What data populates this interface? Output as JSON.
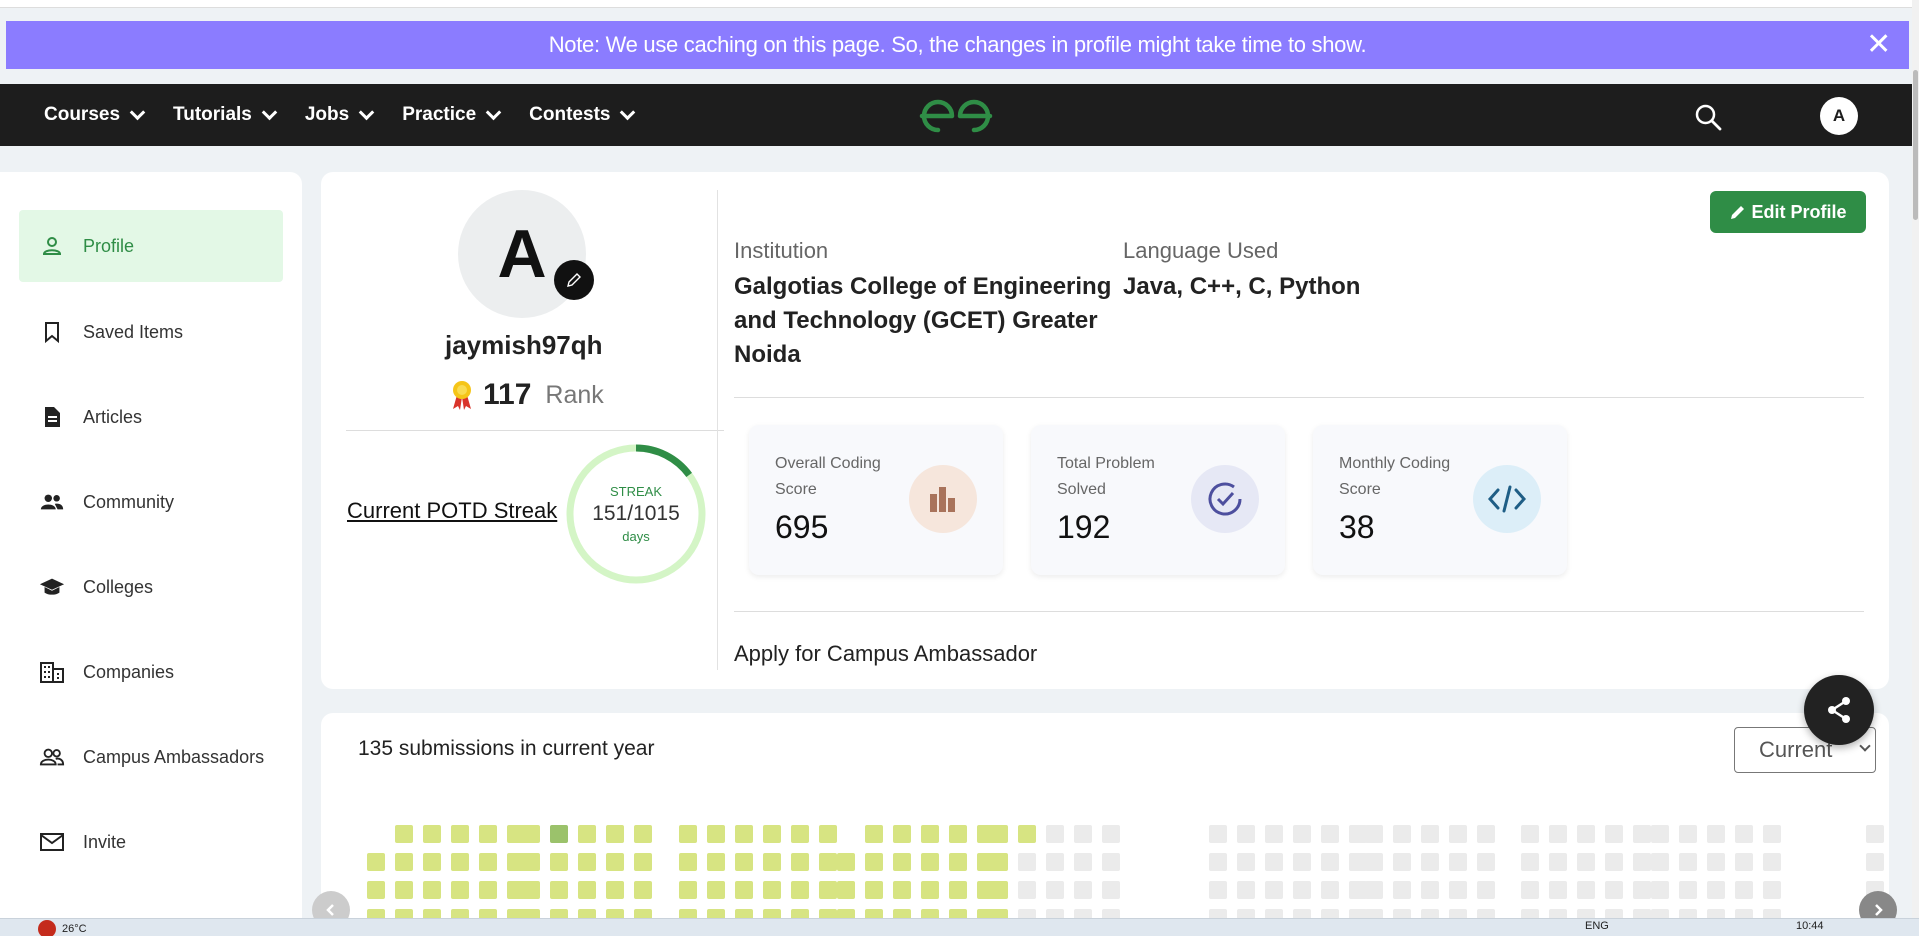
{
  "notice": {
    "text": "Note: We use caching on this page. So, the changes in profile might take time to show.",
    "close": "✕"
  },
  "nav": {
    "items": [
      "Courses",
      "Tutorials",
      "Jobs",
      "Practice",
      "Contests"
    ],
    "avatar_initial": "A"
  },
  "sidebar": {
    "items": [
      {
        "label": "Profile",
        "icon": "person-icon",
        "active": true
      },
      {
        "label": "Saved Items",
        "icon": "bookmark-icon"
      },
      {
        "label": "Articles",
        "icon": "article-icon"
      },
      {
        "label": "Community",
        "icon": "community-icon"
      },
      {
        "label": "Colleges",
        "icon": "graduation-cap-icon"
      },
      {
        "label": "Companies",
        "icon": "building-icon"
      },
      {
        "label": "Campus Ambassadors",
        "icon": "people-icon"
      },
      {
        "label": "Invite",
        "icon": "mail-icon"
      }
    ]
  },
  "profile": {
    "initial": "A",
    "username": "jaymish97qh",
    "rank": "117",
    "rank_label": "Rank",
    "potd_link": "Current POTD Streak",
    "streak_label": "STREAK",
    "streak_value": "151/1015",
    "streak_days": "days",
    "streak_fraction": 0.149
  },
  "info": {
    "institution_label": "Institution",
    "institution_value": "Galgotias College of Engineering and Technology (GCET) Greater Noida",
    "language_label": "Language Used",
    "language_value": "Java, C++, C, Python",
    "edit_button": "Edit Profile"
  },
  "stats": [
    {
      "label": "Overall Coding Score",
      "value": "695",
      "icon": "bar-chart-icon",
      "color": "#f6e6dc"
    },
    {
      "label": "Total Problem Solved",
      "value": "192",
      "icon": "check-circle-icon",
      "color": "#e6e8f5"
    },
    {
      "label": "Monthly Coding Score",
      "value": "38",
      "icon": "code-icon",
      "color": "#dceef8"
    }
  ],
  "campus_link": "Apply for Campus Ambassador",
  "heatmap": {
    "submissions_text": "135 submissions in current year",
    "select_value": "Current",
    "active_color": "#d7e482",
    "strong_color": "#9bc26b",
    "empty_color": "#ebebeb"
  },
  "taskbar": {
    "weather": "26°C",
    "lang": "ENG",
    "time": "10:44"
  }
}
